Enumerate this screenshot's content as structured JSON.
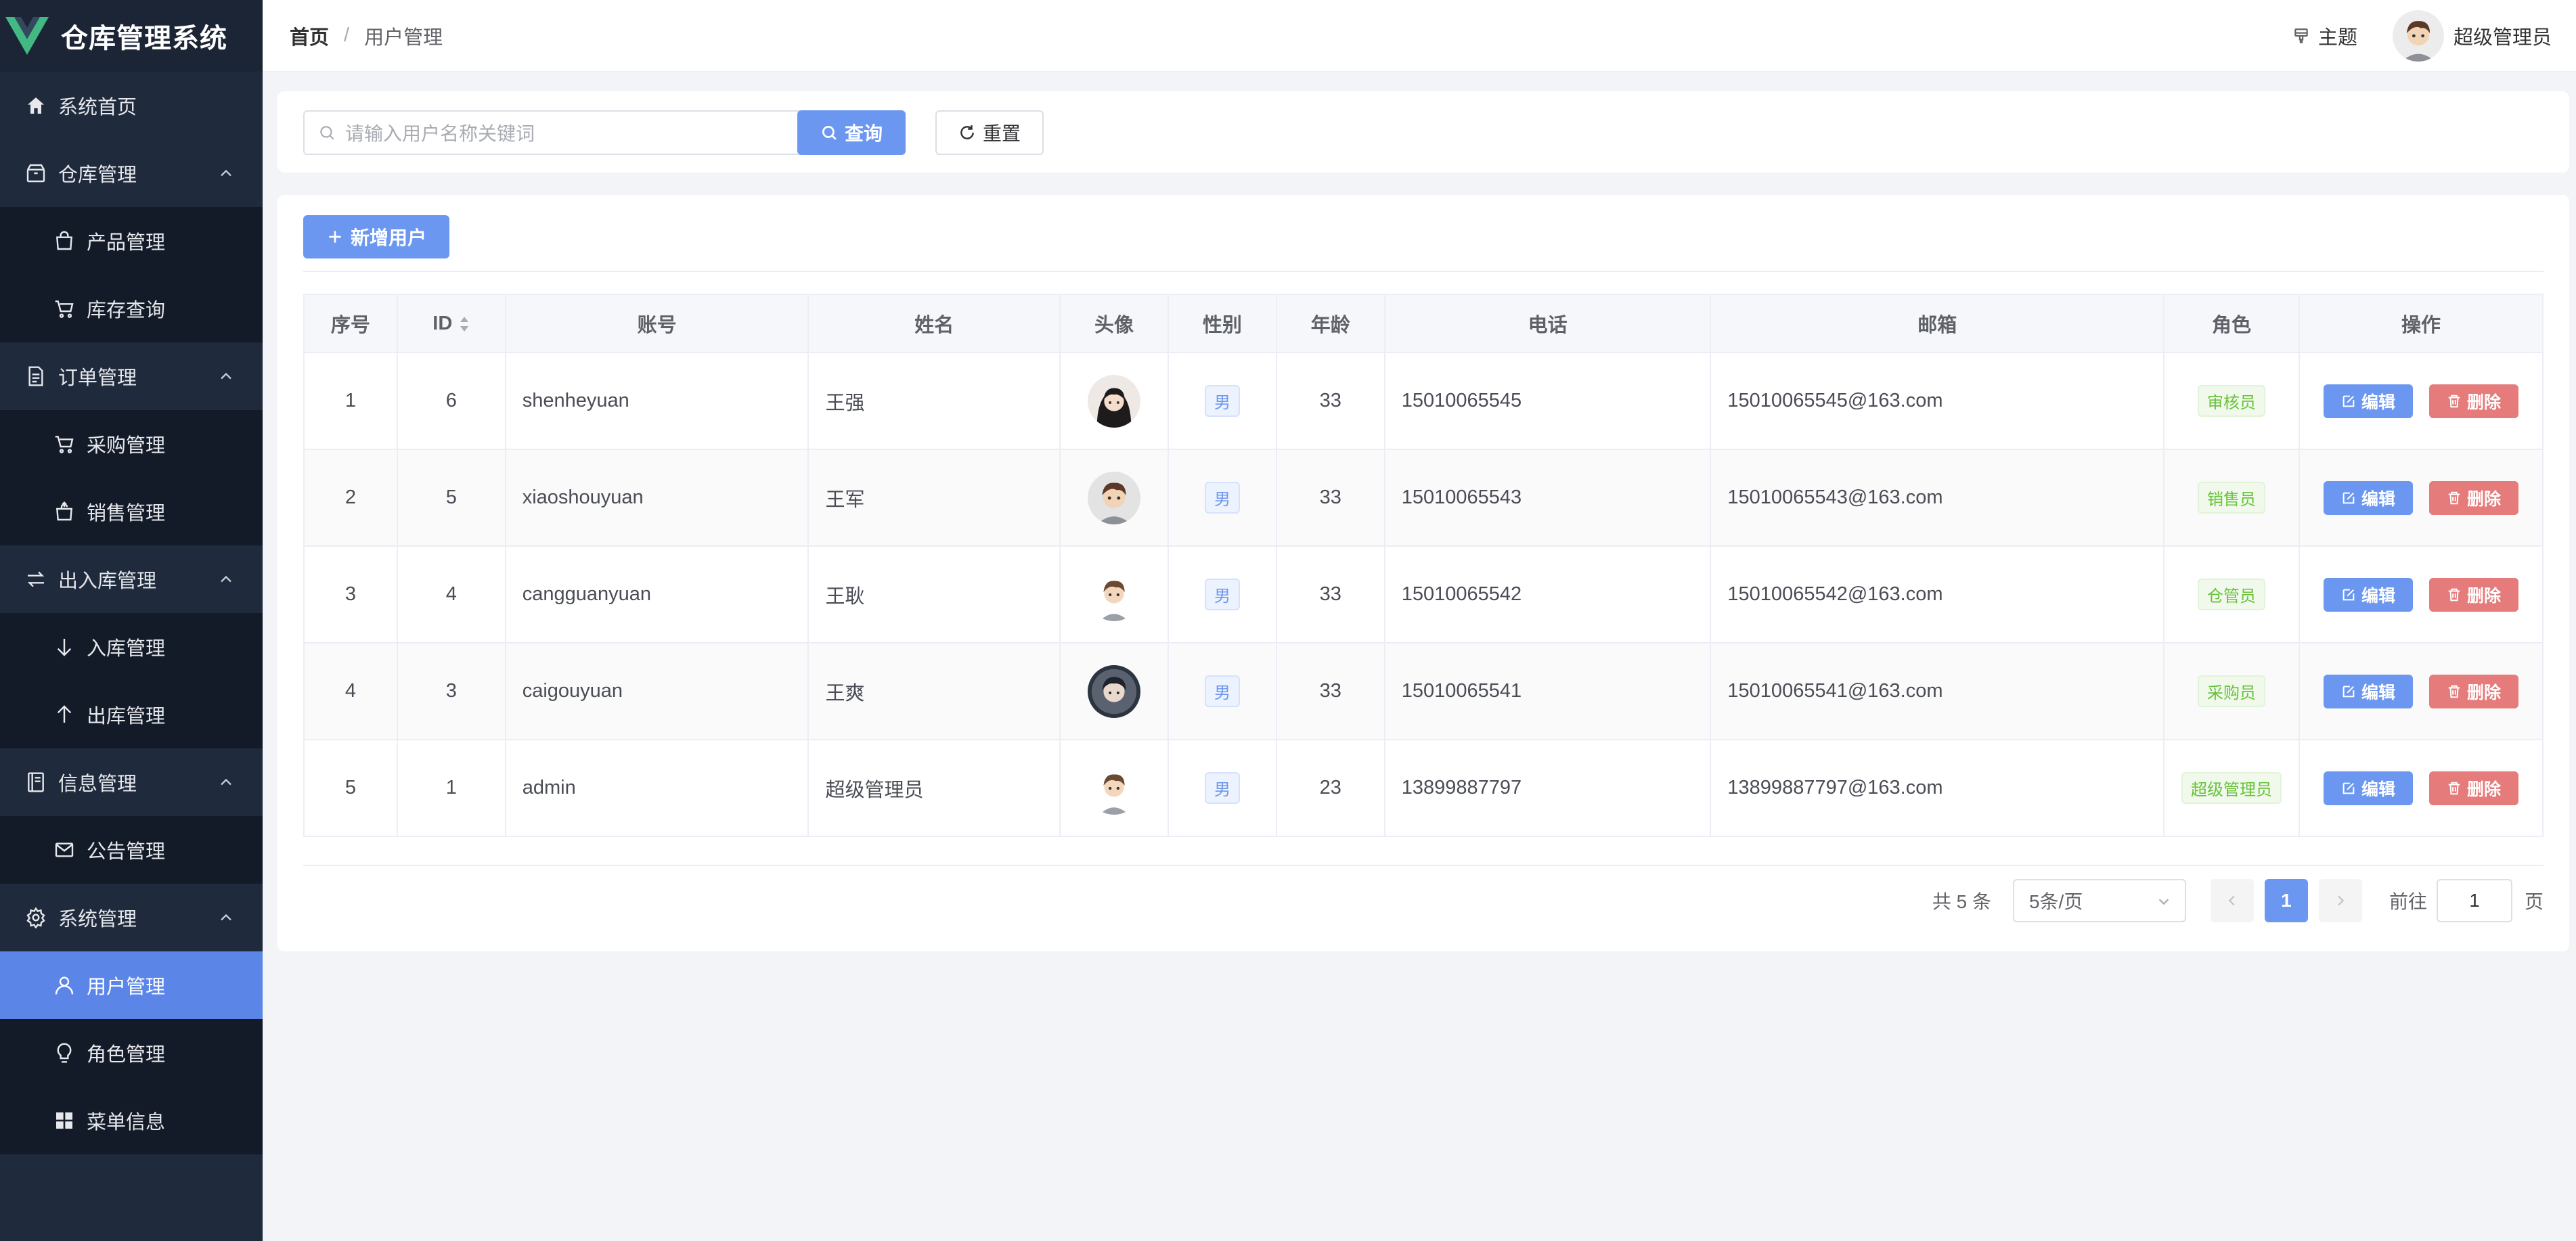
{
  "app": {
    "title": "仓库管理系统"
  },
  "sidebar": {
    "items": [
      {
        "label": "系统首页",
        "level": "top",
        "icon": "home-icon"
      },
      {
        "label": "仓库管理",
        "level": "top",
        "icon": "box-icon",
        "expanded": true
      },
      {
        "label": "产品管理",
        "level": "sub",
        "icon": "bag-icon"
      },
      {
        "label": "库存查询",
        "level": "sub",
        "icon": "cart-icon"
      },
      {
        "label": "订单管理",
        "level": "top",
        "icon": "document-icon",
        "expanded": true
      },
      {
        "label": "采购管理",
        "level": "sub",
        "icon": "cart-icon"
      },
      {
        "label": "销售管理",
        "level": "sub",
        "icon": "sell-icon"
      },
      {
        "label": "出入库管理",
        "level": "top",
        "icon": "switch-icon",
        "expanded": true
      },
      {
        "label": "入库管理",
        "level": "sub",
        "icon": "arrow-down-icon"
      },
      {
        "label": "出库管理",
        "level": "sub",
        "icon": "arrow-up-icon"
      },
      {
        "label": "信息管理",
        "level": "top",
        "icon": "notebook-icon",
        "expanded": true
      },
      {
        "label": "公告管理",
        "level": "sub",
        "icon": "message-icon"
      },
      {
        "label": "系统管理",
        "level": "top",
        "icon": "gear-icon",
        "expanded": true
      },
      {
        "label": "用户管理",
        "level": "sub",
        "icon": "user-icon",
        "active": true
      },
      {
        "label": "角色管理",
        "level": "sub",
        "icon": "bulb-icon"
      },
      {
        "label": "菜单信息",
        "level": "sub",
        "icon": "grid-icon"
      }
    ]
  },
  "header": {
    "breadcrumb_home": "首页",
    "breadcrumb_sep": "/",
    "breadcrumb_current": "用户管理",
    "theme_label": "主题",
    "user_name": "超级管理员"
  },
  "search": {
    "placeholder": "请输入用户名称关键词",
    "query_label": "查询",
    "reset_label": "重置"
  },
  "toolbar": {
    "add_label": "新增用户"
  },
  "table": {
    "columns": [
      "序号",
      "ID",
      "账号",
      "姓名",
      "头像",
      "性别",
      "年龄",
      "电话",
      "邮箱",
      "角色",
      "操作"
    ],
    "edit_label": "编辑",
    "delete_label": "删除",
    "rows": [
      {
        "index": "1",
        "id": "6",
        "account": "shenheyuan",
        "name": "王强",
        "gender": "男",
        "age": "33",
        "phone": "15010065545",
        "email": "15010065545@163.com",
        "role": "审核员"
      },
      {
        "index": "2",
        "id": "5",
        "account": "xiaoshouyuan",
        "name": "王军",
        "gender": "男",
        "age": "33",
        "phone": "15010065543",
        "email": "15010065543@163.com",
        "role": "销售员"
      },
      {
        "index": "3",
        "id": "4",
        "account": "cangguanyuan",
        "name": "王耿",
        "gender": "男",
        "age": "33",
        "phone": "15010065542",
        "email": "15010065542@163.com",
        "role": "仓管员"
      },
      {
        "index": "4",
        "id": "3",
        "account": "caigouyuan",
        "name": "王爽",
        "gender": "男",
        "age": "33",
        "phone": "15010065541",
        "email": "15010065541@163.com",
        "role": "采购员"
      },
      {
        "index": "5",
        "id": "1",
        "account": "admin",
        "name": "超级管理员",
        "gender": "男",
        "age": "23",
        "phone": "13899887797",
        "email": "13899887797@163.com",
        "role": "超级管理员"
      }
    ]
  },
  "pagination": {
    "total_text": "共 5 条",
    "page_size": "5条/页",
    "current_page": "1",
    "goto_label": "前往",
    "goto_value": "1",
    "page_suffix": "页"
  },
  "colors": {
    "sidebar_bg": "#1f2a3c",
    "accent": "#6b97f0",
    "danger": "#e57b7b",
    "success": "#67c23a"
  }
}
